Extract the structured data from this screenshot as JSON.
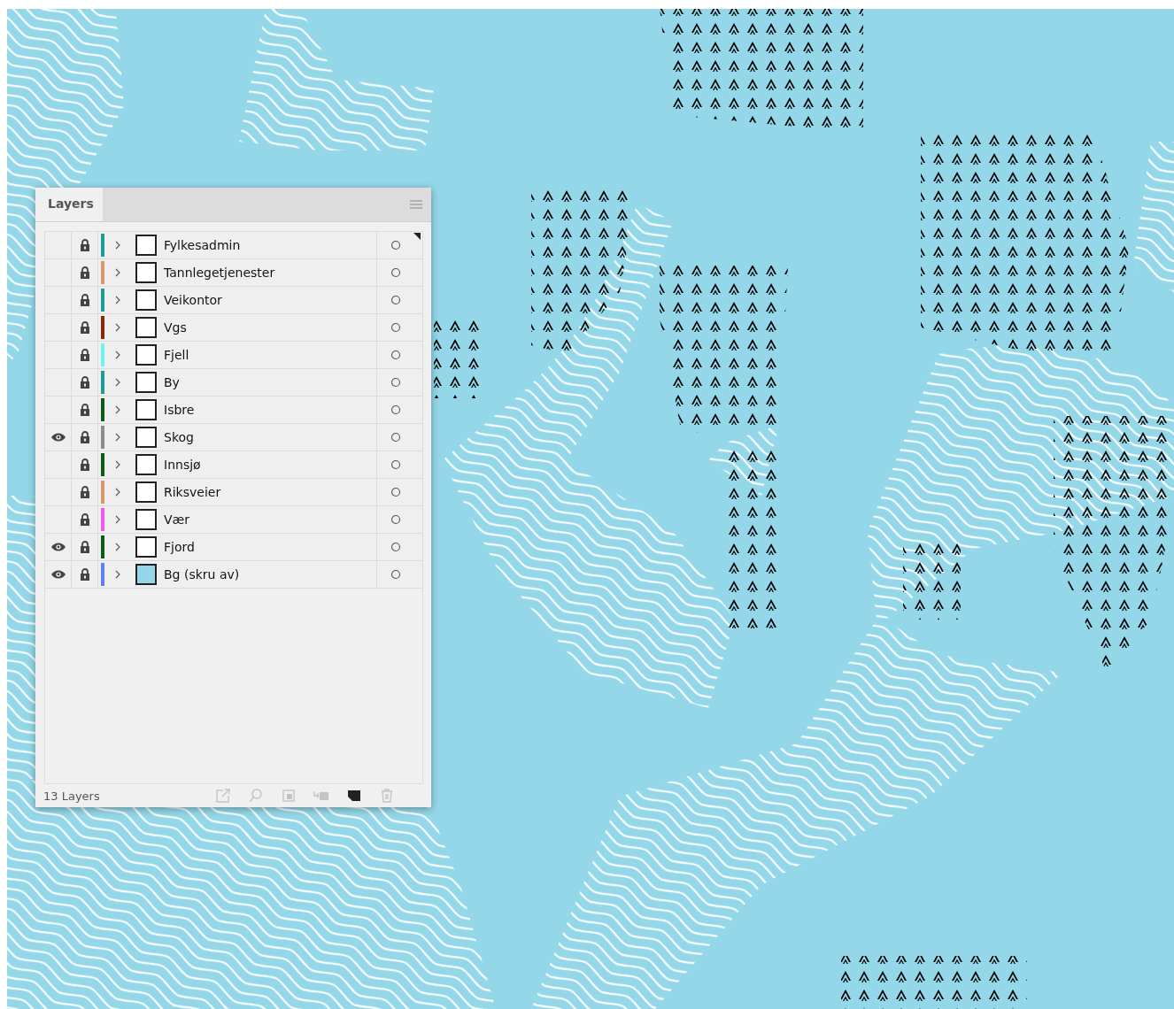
{
  "panel": {
    "tab": "Layers",
    "layers": [
      {
        "name": "Fylkesadmin",
        "visible": false,
        "locked": true,
        "color": "#1f9a9a",
        "thumbnail_filled": false,
        "current": true
      },
      {
        "name": "Tannlegetjenester",
        "visible": false,
        "locked": true,
        "color": "#d69a6c",
        "thumbnail_filled": false,
        "current": false
      },
      {
        "name": "Veikontor",
        "visible": false,
        "locked": true,
        "color": "#1f9a9a",
        "thumbnail_filled": false,
        "current": false
      },
      {
        "name": "Vgs",
        "visible": false,
        "locked": true,
        "color": "#8a2a0a",
        "thumbnail_filled": false,
        "current": false
      },
      {
        "name": "Fjell",
        "visible": false,
        "locked": true,
        "color": "#6ff2f2",
        "thumbnail_filled": false,
        "current": false
      },
      {
        "name": "By",
        "visible": false,
        "locked": true,
        "color": "#1f9a9a",
        "thumbnail_filled": false,
        "current": false
      },
      {
        "name": "Isbre",
        "visible": false,
        "locked": true,
        "color": "#0f5a1a",
        "thumbnail_filled": false,
        "current": false
      },
      {
        "name": "Skog",
        "visible": true,
        "locked": true,
        "color": "#8c8c8c",
        "thumbnail_filled": false,
        "current": false
      },
      {
        "name": "Innsjø",
        "visible": false,
        "locked": true,
        "color": "#0f5a1a",
        "thumbnail_filled": false,
        "current": false
      },
      {
        "name": "Riksveier",
        "visible": false,
        "locked": true,
        "color": "#d69a6c",
        "thumbnail_filled": false,
        "current": false
      },
      {
        "name": "Vær",
        "visible": false,
        "locked": true,
        "color": "#f05ae8",
        "thumbnail_filled": false,
        "current": false
      },
      {
        "name": "Fjord",
        "visible": true,
        "locked": true,
        "color": "#0f5a1a",
        "thumbnail_filled": false,
        "current": false
      },
      {
        "name": "Bg (skru av)",
        "visible": true,
        "locked": true,
        "color": "#5b82f0",
        "thumbnail_filled": true,
        "current": false
      }
    ],
    "status": "13 Layers",
    "footer_buttons": [
      {
        "kind": "export",
        "disabled": true
      },
      {
        "kind": "locate",
        "disabled": true
      },
      {
        "kind": "clip",
        "disabled": true
      },
      {
        "kind": "sublayer",
        "disabled": true
      },
      {
        "kind": "newlayer",
        "disabled": false
      },
      {
        "kind": "delete",
        "disabled": true
      }
    ]
  }
}
